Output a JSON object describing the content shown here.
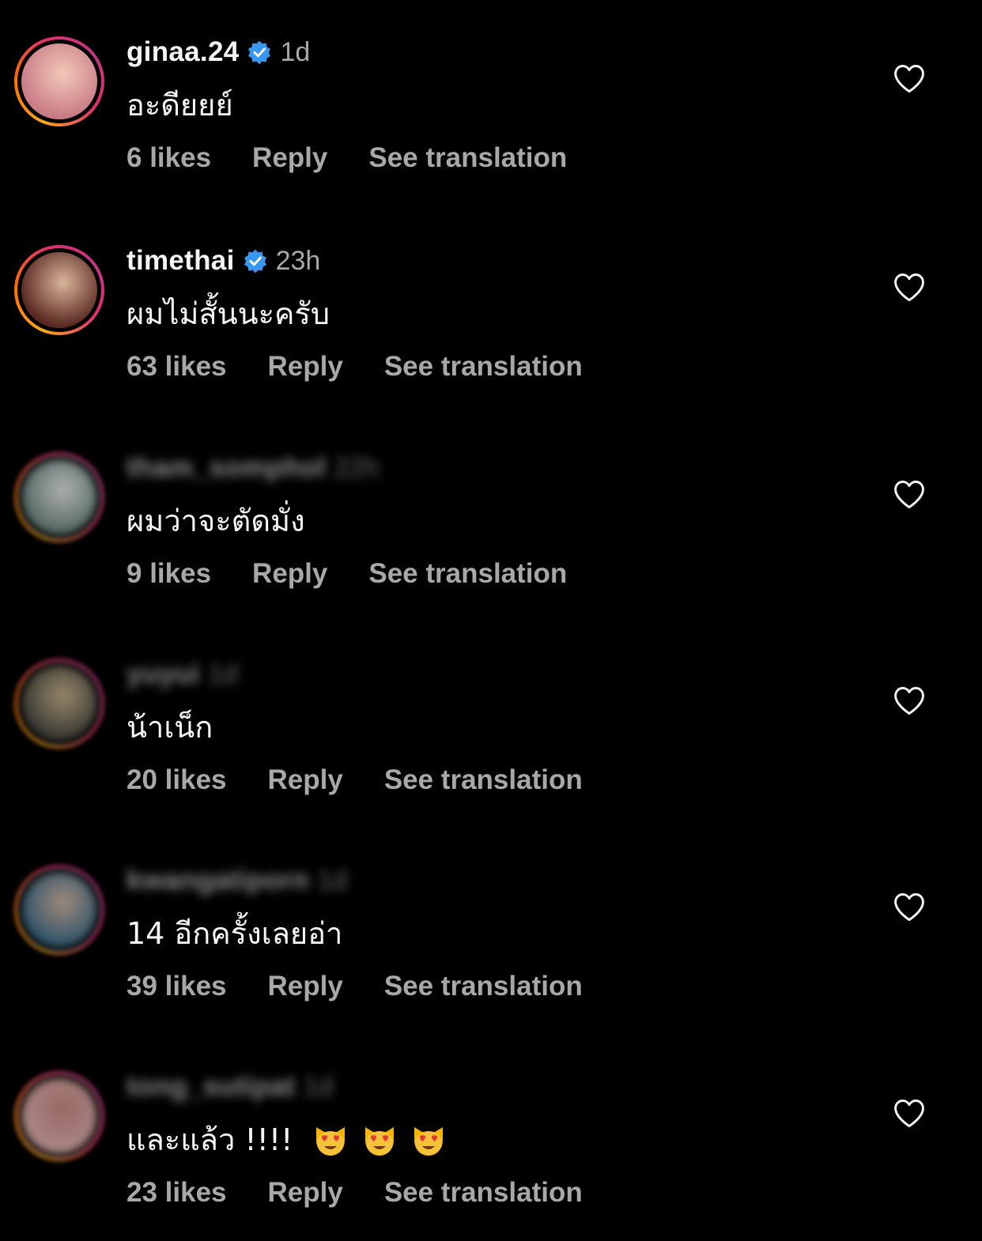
{
  "comments": [
    {
      "username": "ginaa.24",
      "verified": true,
      "time": "1d",
      "text": "อะดียยย์",
      "likes": "6 likes",
      "reply": "Reply",
      "translate": "See translation",
      "blurred": false,
      "avatar_colors": [
        "#c97c86",
        "#f3c8b8"
      ]
    },
    {
      "username": "timethai",
      "verified": true,
      "time": "23h",
      "text": "ผมไม่สั้นนะครับ",
      "likes": "63 likes",
      "reply": "Reply",
      "translate": "See translation",
      "blurred": false,
      "avatar_colors": [
        "#5a2a22",
        "#d9b59a"
      ]
    },
    {
      "username": "tham_somphol",
      "verified": false,
      "time": "22h",
      "text": "ผมว่าจะตัดมั่ง",
      "likes": "9 likes",
      "reply": "Reply",
      "translate": "See translation",
      "blurred": true,
      "avatar_colors": [
        "#6f8a86",
        "#e8ece8"
      ]
    },
    {
      "username": "yuyui",
      "verified": false,
      "time": "1d",
      "text": "น้าเน็ก",
      "likes": "20 likes",
      "reply": "Reply",
      "translate": "See translation",
      "blurred": true,
      "avatar_colors": [
        "#4a4a44",
        "#c9b58d"
      ]
    },
    {
      "username": "kwangatiporn",
      "verified": false,
      "time": "1d",
      "text": "14 อีกครั้งเลยอ่า",
      "likes": "39 likes",
      "reply": "Reply",
      "translate": "See translation",
      "blurred": true,
      "avatar_colors": [
        "#3c6f8e",
        "#d7b8a4"
      ]
    },
    {
      "username": "tong_sutipat",
      "verified": false,
      "time": "1d",
      "text": "และแล้ว !!!!",
      "emojis": [
        "heart-eyes-cat",
        "heart-eyes-cat",
        "heart-eyes-cat"
      ],
      "likes": "23 likes",
      "reply": "Reply",
      "translate": "See translation",
      "blurred": true,
      "avatar_colors": [
        "#e6b7b4",
        "#c98b86"
      ]
    }
  ],
  "colors": {
    "background": "#000000",
    "primary_text": "#f5f5f5",
    "secondary_text": "#a8a8a8",
    "verified": "#3897f0"
  }
}
